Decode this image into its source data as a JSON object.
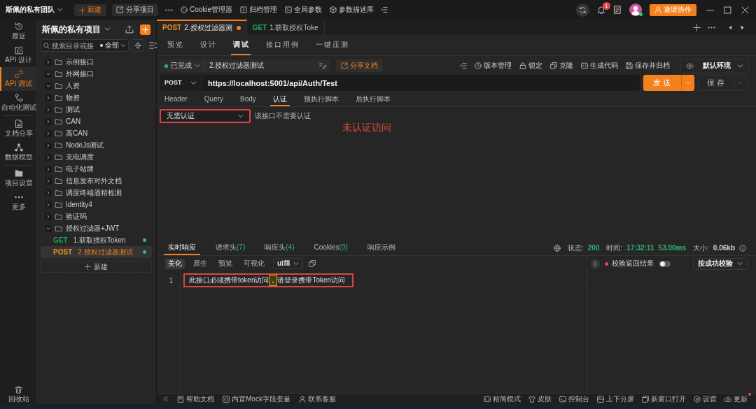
{
  "topbar": {
    "team": "斯佩的私有团队",
    "new_button": "新建",
    "share_button": "分享项目",
    "tools": [
      "Cookie管理器",
      "归档管理",
      "全局参数",
      "参数描述库"
    ],
    "notifications": "1",
    "avatar": {
      "online": true
    },
    "invite_button": "邀请协作"
  },
  "nav": [
    [
      {
        "label": "最近",
        "selected": false
      },
      {
        "label": "API 设计",
        "selected": false
      },
      {
        "label": "API 调试",
        "selected": true
      },
      {
        "label": "自动化测试",
        "selected": false
      }
    ],
    [
      {
        "label": "文档分享",
        "selected": false
      },
      {
        "label": "数据模型",
        "selected": false
      }
    ],
    [
      {
        "label": "项目设置",
        "selected": false
      },
      {
        "label": "更多",
        "selected": false
      }
    ]
  ],
  "trash": "回收站",
  "sidebar": {
    "project": "斯佩的私有项目",
    "search": {
      "placeholder": "搜索目录或接"
    },
    "filter": "全部",
    "tree": [
      {
        "kind": "folder",
        "label": "示例接口",
        "expanded": false
      },
      {
        "kind": "folder",
        "label": "外网接口",
        "expanded": true
      },
      {
        "kind": "folder",
        "label": "人资",
        "expanded": true
      },
      {
        "kind": "folder",
        "label": "物资",
        "expanded": false
      },
      {
        "kind": "folder",
        "label": "测试",
        "expanded": false
      },
      {
        "kind": "folder",
        "label": "CAN",
        "expanded": false
      },
      {
        "kind": "folder",
        "label": "高CAN",
        "expanded": false
      },
      {
        "kind": "folder",
        "label": "NodeJs测试",
        "expanded": false
      },
      {
        "kind": "folder",
        "label": "充电调度",
        "expanded": false
      },
      {
        "kind": "folder",
        "label": "电子站牌",
        "expanded": false
      },
      {
        "kind": "folder",
        "label": "信息发布对外文档",
        "expanded": false
      },
      {
        "kind": "folder",
        "label": "调度终端酒精检测",
        "expanded": false
      },
      {
        "kind": "folder",
        "label": "Identity4",
        "expanded": false
      },
      {
        "kind": "folder",
        "label": "验证码",
        "expanded": false
      },
      {
        "kind": "folder",
        "label": "授权过滤器+JWT",
        "expanded": true,
        "children": [
          {
            "kind": "endpoint",
            "method": {
              "label": "GET",
              "color": "#1fa35c"
            },
            "label": "1.获取授权Token",
            "selected": false,
            "status": {
              "color": "#2fb39b"
            }
          },
          {
            "kind": "endpoint",
            "method": {
              "label": "POST",
              "color": "#f0901e"
            },
            "label": "2.授权过滤器测试",
            "selected": true,
            "status": {
              "color": "#2fb39b"
            }
          }
        ]
      }
    ],
    "new_button": "新建"
  },
  "tabs": [
    {
      "method": {
        "label": "POST",
        "color": "#f0901e"
      },
      "label": "2.授权过滤器测",
      "modified": true,
      "selected": true
    },
    {
      "method": {
        "label": "GET",
        "color": "#1fa35c"
      },
      "label": "1.获取授权Toke",
      "modified": false,
      "selected": false
    }
  ],
  "view_tabs": [
    {
      "label": "预览",
      "selected": false
    },
    {
      "label": "设计",
      "selected": false
    },
    {
      "label": "调试",
      "selected": true
    },
    {
      "label": "接口用例",
      "selected": false
    },
    {
      "label": "一键压测",
      "selected": false
    }
  ],
  "request": {
    "status": {
      "label": "已完成",
      "color": "#2bb673"
    },
    "name": "2.授权过滤器测试",
    "share_button": "分享文档",
    "actions": [
      "版本管理",
      "锁定",
      "克隆",
      "生成代码",
      "保存并归档"
    ],
    "environment": "默认环境",
    "method": "POST",
    "url": "https://localhost:5001/api/Auth/Test",
    "send_button": "发送",
    "save_button": "保存"
  },
  "request_tabs": [
    {
      "label": "Header",
      "selected": false
    },
    {
      "label": "Query",
      "selected": false
    },
    {
      "label": "Body",
      "selected": false
    },
    {
      "label": "认证",
      "selected": true
    },
    {
      "label": "预执行脚本",
      "selected": false
    },
    {
      "label": "后执行脚本",
      "selected": false
    }
  ],
  "auth": {
    "type": "无需认证",
    "note": "该接口不需要认证",
    "highlighted": true
  },
  "annotation": "未认证访问",
  "response": {
    "tabs": [
      {
        "label": "实时响应",
        "selected": true
      },
      {
        "label": "请求头",
        "count": "(7)",
        "selected": false
      },
      {
        "label": "响应头",
        "count": "(4)",
        "selected": false
      },
      {
        "label": "Cookies",
        "count": "(0)",
        "selected": false
      },
      {
        "label": "响应示例",
        "selected": false
      }
    ],
    "stats": [
      {
        "label": "状态:",
        "value": "200",
        "color": "#2bb673"
      },
      {
        "label": "时间:",
        "value": "17:32:11",
        "color": "#2bb673"
      },
      {
        "value": "53.00ms",
        "color": "#2bb673"
      },
      {
        "label": "大小:",
        "value": "0.06kb",
        "color": "#d0d0d0"
      }
    ],
    "formats": [
      {
        "label": "美化",
        "selected": true
      },
      {
        "label": "原生",
        "selected": false
      },
      {
        "label": "预览",
        "selected": false
      },
      {
        "label": "可视化",
        "selected": false
      }
    ],
    "encoding": "utf8",
    "lines": [
      {
        "number": "1",
        "highlighted": true,
        "parts": [
          {
            "text": "此接口必须携带token访问",
            "flagged": false
          },
          {
            "text": "，",
            "flagged": true
          },
          {
            "text": "请登录携带Token访问",
            "flagged": false
          }
        ]
      }
    ],
    "validation": {
      "label": "校验返回结果",
      "on": false,
      "mode": "按成功校验"
    }
  },
  "footer": {
    "left": [
      "帮助文档",
      "内置Mock字段变量",
      "联系客服"
    ],
    "right": [
      {
        "label": "精简模式",
        "dot": false
      },
      {
        "label": "皮肤",
        "dot": false
      },
      {
        "label": "控制台",
        "dot": false
      },
      {
        "label": "上下分屏",
        "dot": false
      },
      {
        "label": "新窗口打开",
        "dot": false
      },
      {
        "label": "设置",
        "dot": false
      },
      {
        "label": "更新",
        "dot": true
      }
    ]
  }
}
